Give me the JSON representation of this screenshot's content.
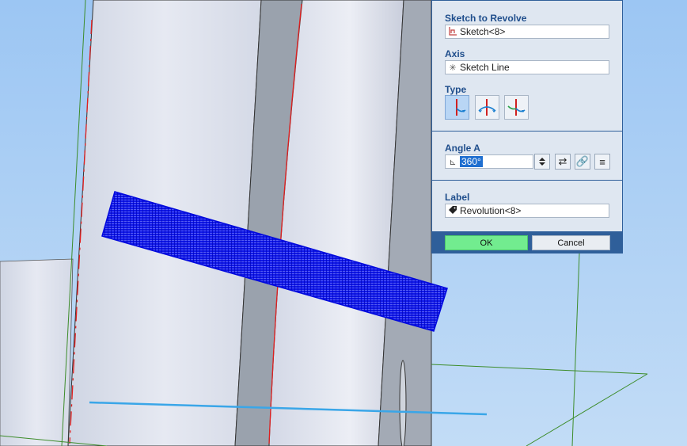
{
  "panel": {
    "sketch_section": {
      "title": "Sketch to Revolve",
      "value": "Sketch<8>",
      "icon": "sketch-icon"
    },
    "axis_section": {
      "title": "Axis",
      "value": "Sketch Line",
      "icon": "axis-line-icon"
    },
    "type_section": {
      "title": "Type",
      "options": [
        {
          "icon": "revolve-one-direction-icon",
          "selected": true
        },
        {
          "icon": "revolve-symmetric-icon",
          "selected": false
        },
        {
          "icon": "revolve-two-directions-icon",
          "selected": false
        }
      ]
    },
    "angle_section": {
      "title": "Angle A",
      "value": "360°",
      "icon": "angle-icon"
    },
    "label_section": {
      "title": "Label",
      "value": "Revolution<8>",
      "icon": "tag-icon"
    },
    "buttons": {
      "ok": "OK",
      "cancel": "Cancel"
    }
  },
  "colors": {
    "background": "#a9cdf5",
    "part_face": "#dfe3ef",
    "part_dark": "#9aa2ad",
    "wireframe": "#0008dd",
    "axis_line": "#3aa6e8",
    "construction": "#3d8c2a",
    "edge_red": "#e02020",
    "panel_bg": "#dfe7f1",
    "panel_accent": "#1f4e8c",
    "ok_green": "#72ec8f"
  }
}
